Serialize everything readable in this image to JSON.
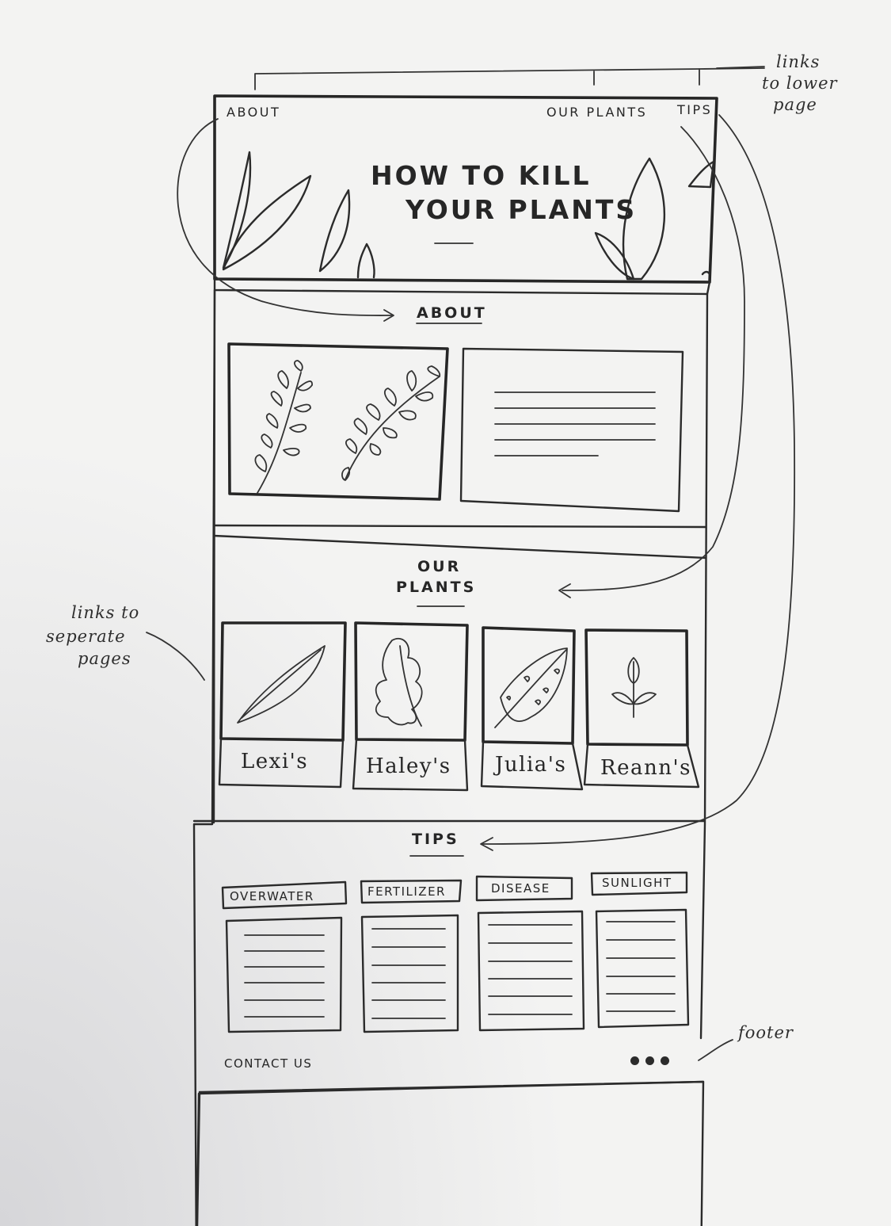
{
  "nav": {
    "about": "ABOUT",
    "our_plants": "OUR PLANTS",
    "tips": "TIPS"
  },
  "hero": {
    "title_line1": "HOW TO KILL",
    "title_line2": "YOUR PLANTS"
  },
  "about": {
    "heading": "ABOUT"
  },
  "our_plants": {
    "heading_line1": "OUR",
    "heading_line2": "PLANTS",
    "cards": [
      {
        "name": "Lexi's"
      },
      {
        "name": "Haley's"
      },
      {
        "name": "Julia's"
      },
      {
        "name": "Reann's"
      }
    ]
  },
  "tips": {
    "heading": "TIPS",
    "labels": [
      "OVERWATER",
      "FERTILIZER",
      "DISEASE",
      "SUNLIGHT"
    ]
  },
  "footer": {
    "contact": "CONTACT US"
  },
  "annotations": {
    "links_lower_page": [
      "links",
      "to lower",
      "page"
    ],
    "links_separate_pages": [
      "links to",
      "seperate",
      "pages"
    ],
    "footer": "footer"
  }
}
